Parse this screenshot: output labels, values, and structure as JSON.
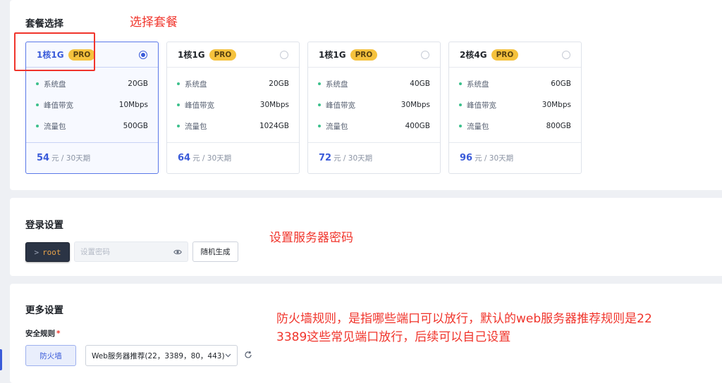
{
  "plan_section": {
    "title": "套餐选择",
    "annotation": "选择套餐",
    "plans": [
      {
        "name": "1核1G",
        "badge": "PRO",
        "selected": true,
        "specs": [
          {
            "label": "系统盘",
            "value": "20GB"
          },
          {
            "label": "峰值带宽",
            "value": "10Mbps"
          },
          {
            "label": "流量包",
            "value": "500GB"
          }
        ],
        "price": "54",
        "price_unit": "元 / 30天期"
      },
      {
        "name": "1核1G",
        "badge": "PRO",
        "selected": false,
        "specs": [
          {
            "label": "系统盘",
            "value": "20GB"
          },
          {
            "label": "峰值带宽",
            "value": "30Mbps"
          },
          {
            "label": "流量包",
            "value": "1024GB"
          }
        ],
        "price": "64",
        "price_unit": "元 / 30天期"
      },
      {
        "name": "1核1G",
        "badge": "PRO",
        "selected": false,
        "specs": [
          {
            "label": "系统盘",
            "value": "40GB"
          },
          {
            "label": "峰值带宽",
            "value": "30Mbps"
          },
          {
            "label": "流量包",
            "value": "400GB"
          }
        ],
        "price": "72",
        "price_unit": "元 / 30天期"
      },
      {
        "name": "2核4G",
        "badge": "PRO",
        "selected": false,
        "specs": [
          {
            "label": "系统盘",
            "value": "60GB"
          },
          {
            "label": "峰值带宽",
            "value": "30Mbps"
          },
          {
            "label": "流量包",
            "value": "800GB"
          }
        ],
        "price": "96",
        "price_unit": "元 / 30天期"
      }
    ]
  },
  "login_section": {
    "title": "登录设置",
    "annotation": "设置服务器密码",
    "user_prompt": ">",
    "username": "root",
    "password_placeholder": "设置密码",
    "random_button": "随机生成"
  },
  "more_section": {
    "title": "更多设置",
    "security_label": "安全规则",
    "required_mark": "*",
    "firewall_button": "防火墙",
    "rule_selected": "Web服务器推荐(22，3389，80，443)",
    "annotation_line1": "防火墙规则，是指哪些端口可以放行，默认的web服务器推荐规则是22",
    "annotation_line2": "3389这些常见端口放行，后续可以自己设置"
  },
  "colors": {
    "accent": "#3a5bd9",
    "annotation_red": "#f0342b",
    "pro_badge": "#f5c23d",
    "spec_dot": "#3cc08c"
  },
  "icons": {
    "password_toggle": "eye-icon",
    "select_arrow": "chevron-down-icon",
    "refresh": "refresh-icon"
  }
}
